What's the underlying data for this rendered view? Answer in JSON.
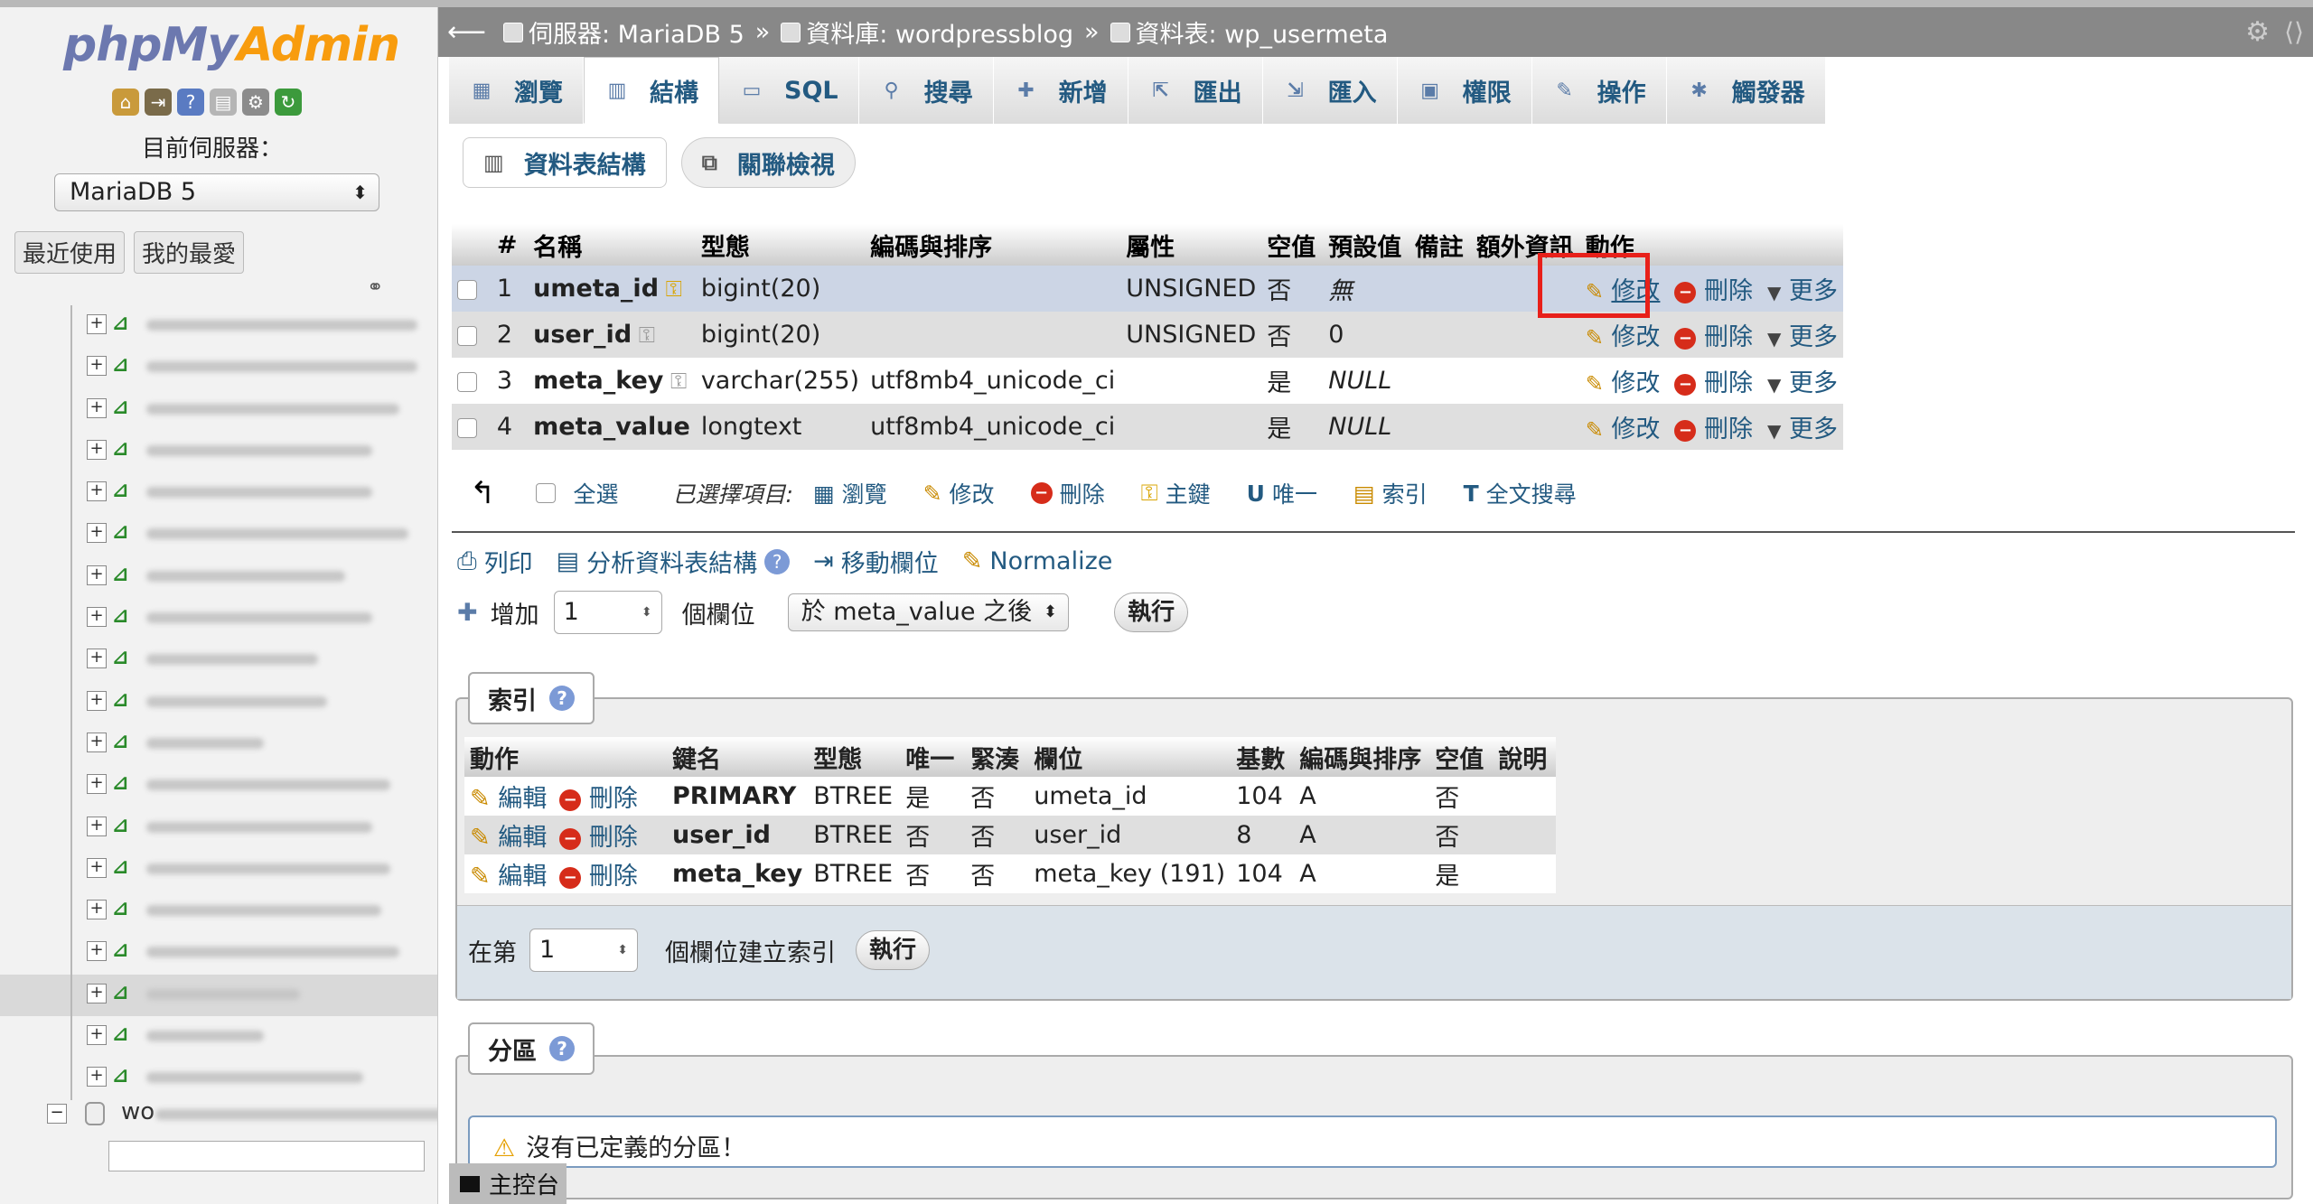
{
  "sidebar": {
    "logo_php": "php",
    "logo_my": "My",
    "logo_admin": "Admin",
    "server_label": "目前伺服器：",
    "server_value": "MariaDB 5",
    "recent_label": "最近使用",
    "favorites_label": "我的最愛",
    "db_name_visible": "wo",
    "tree_count": 19,
    "selected_table_index": 16
  },
  "topbar": {
    "server_crumb": "伺服器: MariaDB 5",
    "database_crumb": "資料庫: wordpressblog",
    "table_crumb": "資料表: wp_usermeta",
    "separator": "»"
  },
  "tabs": [
    {
      "label": "瀏覽",
      "icon": "browse-icon"
    },
    {
      "label": "結構",
      "icon": "structure-icon",
      "active": true
    },
    {
      "label": "SQL",
      "icon": "sql-icon"
    },
    {
      "label": "搜尋",
      "icon": "search-icon"
    },
    {
      "label": "新增",
      "icon": "insert-icon"
    },
    {
      "label": "匯出",
      "icon": "export-icon"
    },
    {
      "label": "匯入",
      "icon": "import-icon"
    },
    {
      "label": "權限",
      "icon": "privileges-icon"
    },
    {
      "label": "操作",
      "icon": "operations-icon"
    },
    {
      "label": "觸發器",
      "icon": "triggers-icon"
    }
  ],
  "subtabs": {
    "table_structure": "資料表結構",
    "relation_view": "關聯檢視"
  },
  "structure": {
    "headers": [
      "#",
      "名稱",
      "型態",
      "編碼與排序",
      "屬性",
      "空值",
      "預設值",
      "備註",
      "額外資訊",
      "動作"
    ],
    "rows": [
      {
        "num": "1",
        "name": "umeta_id",
        "type": "bigint(20)",
        "collation": "",
        "attr": "UNSIGNED",
        "null": "否",
        "default": "無",
        "comment": "",
        "extra": ""
      },
      {
        "num": "2",
        "name": "user_id",
        "type": "bigint(20)",
        "collation": "",
        "attr": "UNSIGNED",
        "null": "否",
        "default": "0",
        "comment": "",
        "extra": ""
      },
      {
        "num": "3",
        "name": "meta_key",
        "type": "varchar(255)",
        "collation": "utf8mb4_unicode_ci",
        "attr": "",
        "null": "是",
        "default": "NULL",
        "comment": "",
        "extra": ""
      },
      {
        "num": "4",
        "name": "meta_value",
        "type": "longtext",
        "collation": "utf8mb4_unicode_ci",
        "attr": "",
        "null": "是",
        "default": "NULL",
        "comment": "",
        "extra": ""
      }
    ],
    "action_edit": "修改",
    "action_delete": "刪除",
    "action_more": "更多"
  },
  "with_selected": {
    "check_all": "全選",
    "label": "已選擇項目:",
    "actions": [
      "瀏覽",
      "修改",
      "刪除",
      "主鍵",
      "唯一",
      "索引",
      "全文搜尋"
    ]
  },
  "tools": {
    "print": "列印",
    "analyze": "分析資料表結構",
    "move_columns": "移動欄位",
    "normalize": "Normalize"
  },
  "add_columns": {
    "label": "增加",
    "count": "1",
    "unit": "個欄位",
    "position": "於 meta_value 之後",
    "go": "執行"
  },
  "indexes": {
    "legend": "索引",
    "headers": [
      "動作",
      "鍵名",
      "型態",
      "唯一",
      "緊湊",
      "欄位",
      "基數",
      "編碼與排序",
      "空值",
      "說明"
    ],
    "rows": [
      {
        "key": "PRIMARY",
        "type": "BTREE",
        "unique": "是",
        "packed": "否",
        "column": "umeta_id",
        "cardinality": "104",
        "collation": "A",
        "null": "否",
        "comment": ""
      },
      {
        "key": "user_id",
        "type": "BTREE",
        "unique": "否",
        "packed": "否",
        "column": "user_id",
        "cardinality": "8",
        "collation": "A",
        "null": "否",
        "comment": ""
      },
      {
        "key": "meta_key",
        "type": "BTREE",
        "unique": "否",
        "packed": "否",
        "column": "meta_key (191)",
        "cardinality": "104",
        "collation": "A",
        "null": "是",
        "comment": ""
      }
    ],
    "edit": "編輯",
    "delete": "刪除",
    "create_prefix": "在第",
    "create_count": "1",
    "create_suffix": "個欄位建立索引",
    "go": "執行"
  },
  "partitions": {
    "legend": "分區",
    "message": "沒有已定義的分區！"
  },
  "console": {
    "label": "主控台"
  }
}
